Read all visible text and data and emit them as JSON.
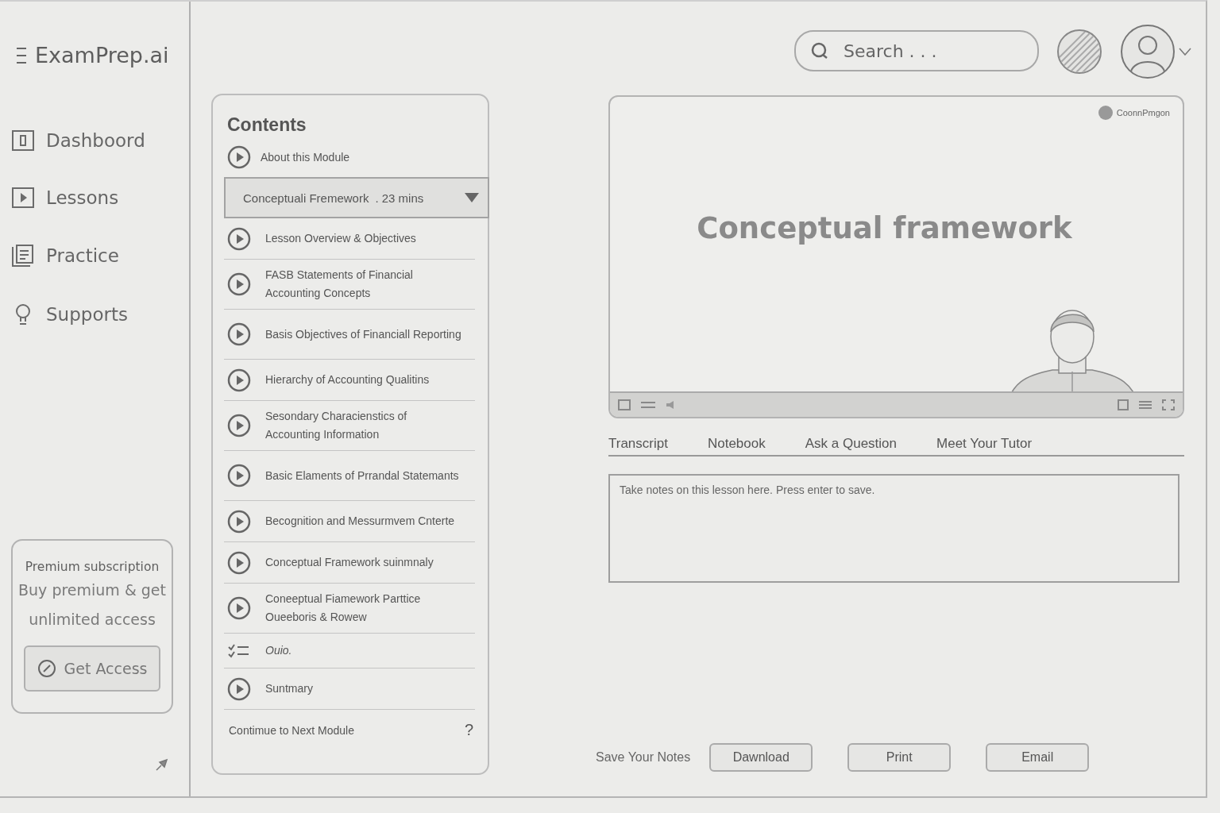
{
  "app": {
    "logo": "ExamPrep.ai"
  },
  "sidebar": {
    "items": [
      {
        "label": "Dashboord",
        "kind": "dashboard"
      },
      {
        "label": "Lessons",
        "kind": "lessons"
      },
      {
        "label": "Practice",
        "kind": "practice"
      },
      {
        "label": "Supports",
        "kind": "supports"
      }
    ]
  },
  "promo": {
    "title": "Premium subscription",
    "text": "Buy premium & get unlimited access",
    "button": "Get Access"
  },
  "header": {
    "search": {
      "placeholder": "Search . . ."
    }
  },
  "contents": {
    "title": "Contents",
    "intro": "About this Module",
    "section": {
      "title": "Conceptuali Fremework",
      "duration": ". 23 mins",
      "expanded": true
    },
    "items": [
      {
        "label": "Lesson Overview & Objectives",
        "kind": "lesson"
      },
      {
        "label": "FASB Statements of Financial Accounting Concepts",
        "kind": "lesson"
      },
      {
        "label": "Basis Objectives of Financiall Reporting",
        "kind": "lesson"
      },
      {
        "label": "Hierarchy of Accounting Qualitins",
        "kind": "lesson"
      },
      {
        "label": "Sesondary Characienstics of Accounting Information",
        "kind": "lesson"
      },
      {
        "label": "Basic Elaments of Prrandal Statemants",
        "kind": "lesson"
      },
      {
        "label": "Becognition and Messurmvem Cnterte",
        "kind": "lesson"
      },
      {
        "label": "Conceptual Framework suinmnaly",
        "kind": "lesson"
      },
      {
        "label": "Coneeptual Fiamework Parttice Oueeboris & Rowew",
        "kind": "lesson"
      },
      {
        "label": "Ouio.",
        "kind": "quiz"
      },
      {
        "label": "Suntmary",
        "kind": "lesson"
      }
    ],
    "footer": "Contimue to Next Module",
    "footer_icon": "?"
  },
  "video": {
    "slide_title": "Conceptual framework",
    "channel": "CoonnPmgon"
  },
  "tabs": [
    {
      "label": "Transcript"
    },
    {
      "label": "Notebook"
    },
    {
      "label": "Ask a Question"
    },
    {
      "label": "Meet Your Tutor"
    }
  ],
  "notes": {
    "placeholder": "Take notes on this lesson here. Press enter to save."
  },
  "save": {
    "label": "Save Your Notes",
    "buttons": [
      "Dawnload",
      "Print",
      "Email"
    ]
  }
}
